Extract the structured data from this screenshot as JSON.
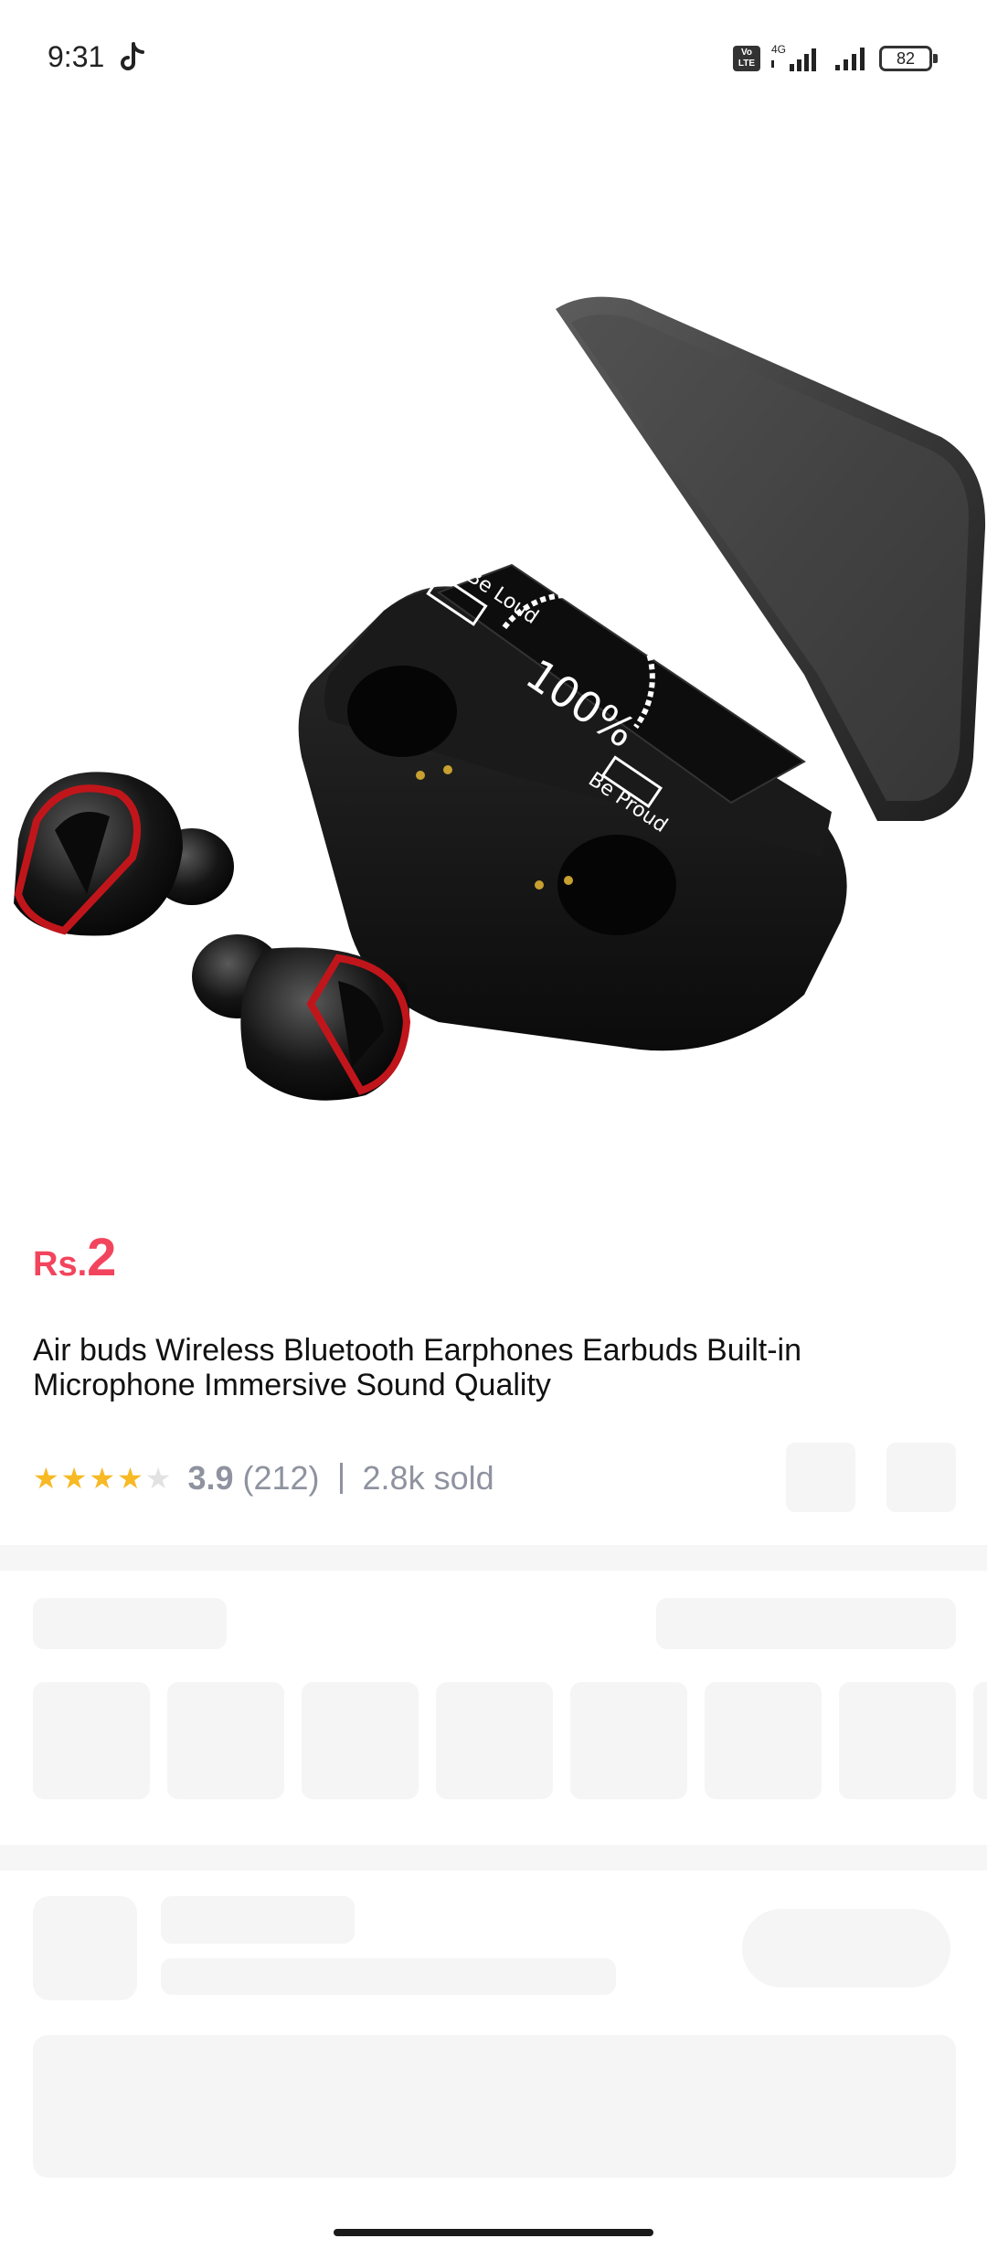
{
  "status_bar": {
    "time": "9:31",
    "volte_label": "Vo LTE",
    "network": "4G",
    "battery": "82"
  },
  "product": {
    "image_icon": "wireless-earbuds-charging-case-image",
    "currency": "Rs.",
    "price": "2",
    "title": "Air buds Wireless Bluetooth Earphones Earbuds Built-in Microphone Immersive Sound Quality",
    "rating_stars": 3.9,
    "rating_value": "3.9",
    "rating_count": "(212)",
    "sold": "2.8k sold",
    "case_display_top": "Be Loud",
    "case_display_percent": "100%",
    "case_display_bottom": "Be Proud"
  },
  "colors": {
    "price": "#f2455d",
    "star": "#f7b924",
    "meta_text": "#8f93a0",
    "skeleton": "#f5f5f5"
  }
}
